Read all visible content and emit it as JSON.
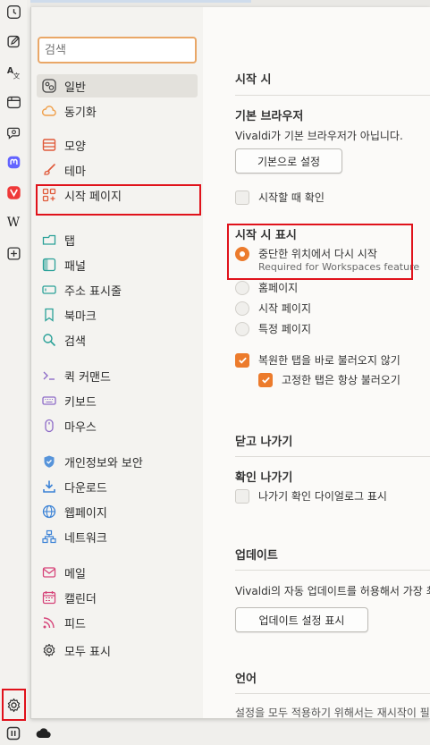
{
  "panel_bar": {
    "icons": [
      "clock-icon",
      "notes-icon",
      "translate-icon",
      "window-icon",
      "chat-icon",
      "mastodon-icon",
      "vivaldi-icon",
      "wikipedia-icon",
      "add-panel-icon"
    ],
    "wikipedia_letter": "W",
    "settings_icon": "gear-icon",
    "bottom_icons": [
      "pause-icon",
      "cloud-icon"
    ]
  },
  "search": {
    "placeholder": "검색"
  },
  "sidebar": {
    "items": [
      {
        "label": "일반",
        "icon": "general-icon",
        "active": true
      },
      {
        "label": "동기화",
        "icon": "cloud-icon"
      },
      {
        "label": "모양",
        "icon": "appearance-icon"
      },
      {
        "label": "테마",
        "icon": "brush-icon"
      },
      {
        "label": "시작 페이지",
        "icon": "start-page-icon"
      },
      {
        "label": "탭",
        "icon": "tab-icon"
      },
      {
        "label": "패널",
        "icon": "panel-icon"
      },
      {
        "label": "주소 표시줄",
        "icon": "address-bar-icon"
      },
      {
        "label": "북마크",
        "icon": "bookmark-icon"
      },
      {
        "label": "검색",
        "icon": "search-icon"
      },
      {
        "label": "퀵 커맨드",
        "icon": "quick-command-icon"
      },
      {
        "label": "키보드",
        "icon": "keyboard-icon"
      },
      {
        "label": "마우스",
        "icon": "mouse-icon"
      },
      {
        "label": "개인정보와 보안",
        "icon": "shield-icon"
      },
      {
        "label": "다운로드",
        "icon": "download-icon"
      },
      {
        "label": "웹페이지",
        "icon": "globe-icon"
      },
      {
        "label": "네트워크",
        "icon": "network-icon"
      },
      {
        "label": "메일",
        "icon": "mail-icon"
      },
      {
        "label": "캘린더",
        "icon": "calendar-icon"
      },
      {
        "label": "피드",
        "icon": "feed-icon"
      },
      {
        "label": "모두 표시",
        "icon": "gear-icon"
      }
    ]
  },
  "content": {
    "startup": {
      "section_title": "시작 시",
      "default_browser_title": "기본 브라우저",
      "default_browser_text": "Vivaldi가 기본 브라우저가 아닙니다.",
      "set_default_button": "기본으로 설정",
      "check_on_startup": "시작할 때 확인",
      "show_on_startup_title": "시작 시 표시",
      "options": [
        "중단한 위치에서 다시 시작",
        "홈페이지",
        "시작 페이지",
        "특정 페이지"
      ],
      "selected_option": "중단한 위치에서 다시 시작",
      "option_hint": "Required for Workspaces feature",
      "lazy_load": "복원한 탭을 바로 불러오지 않기",
      "pinned_always": "고정한 탭은 항상 불러오기"
    },
    "closing": {
      "section_title": "닫고 나가기",
      "confirm_exit_title": "확인 나가기",
      "confirm_exit_dialog": "나가기 확인 다이얼로그 표시"
    },
    "update": {
      "section_title": "업데이트",
      "text": "Vivaldi의 자동 업데이트를 허용해서 가장 최",
      "button": "업데이트 설정 표시"
    },
    "language": {
      "section_title": "언어",
      "text": "설정을 모두 적용하기 위해서는 재시작이 필"
    }
  },
  "colors": {
    "accent": "#ec7b2c",
    "highlight": "#e0121b",
    "vivaldi_red": "#ef3939",
    "mastodon": "#6364ff"
  }
}
